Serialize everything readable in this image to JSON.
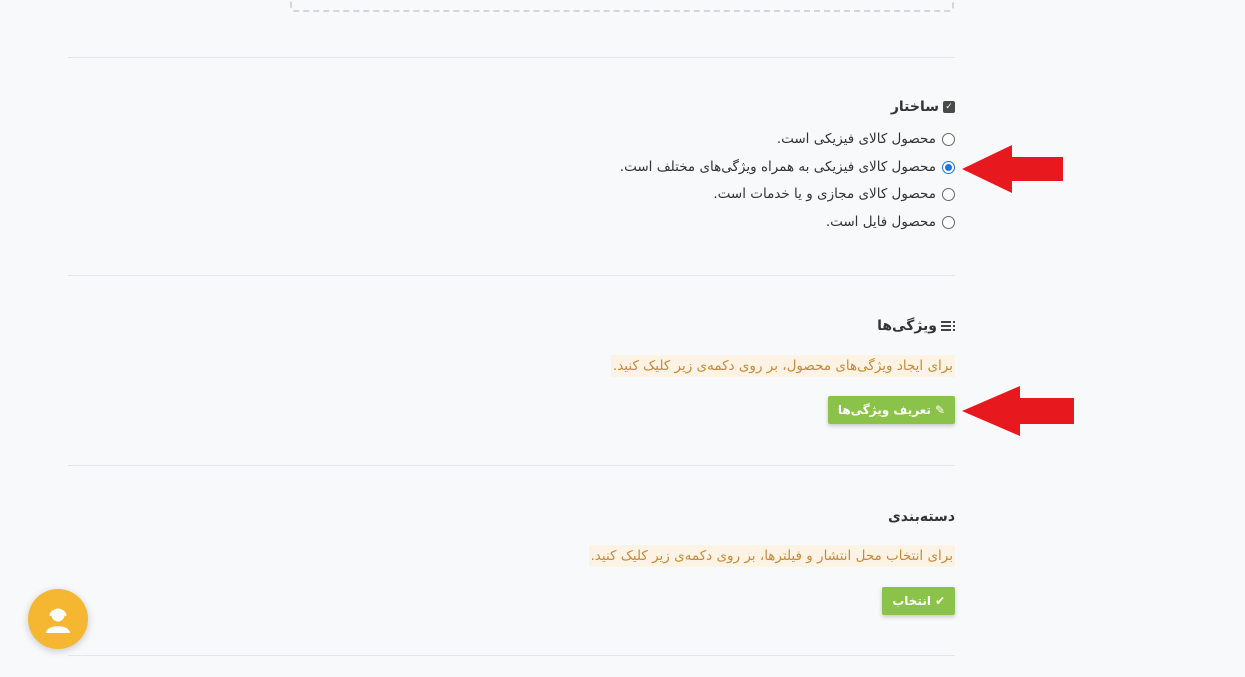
{
  "structure": {
    "title": "ساختار",
    "options": [
      {
        "label": "محصول کالای فیزیکی است.",
        "checked": false
      },
      {
        "label": "محصول کالای فیزیکی به همراه ویژگی‌های مختلف است.",
        "checked": true
      },
      {
        "label": "محصول کالای مجازی و یا خدمات است.",
        "checked": false
      },
      {
        "label": "محصول فایل است.",
        "checked": false
      }
    ]
  },
  "attributes": {
    "title": "ویژگی‌ها",
    "hint": "برای ایجاد ویژگی‌های محصول، بر روی دکمه‌ی زیر کلیک کنید.",
    "button_label": "تعریف ویژگی‌ها"
  },
  "category": {
    "title": "دسته‌بندی",
    "hint": "برای انتخاب محل انتشار و فیلترها، بر روی دکمه‌ی زیر کلیک کنید.",
    "button_label": "انتخاب"
  },
  "colors": {
    "accent_green": "#8bc34a",
    "hint_text": "#c58a3a",
    "hint_bg": "#fdf3e4",
    "arrow_red": "#e8191e",
    "support_yellow": "#f5b731",
    "radio_blue": "#1a73e8"
  },
  "icons": {
    "structure": "checkbox-icon",
    "attributes": "list-icon",
    "attributes_button": "pencil-icon",
    "category_button": "check-icon",
    "support": "support-agent-icon"
  }
}
